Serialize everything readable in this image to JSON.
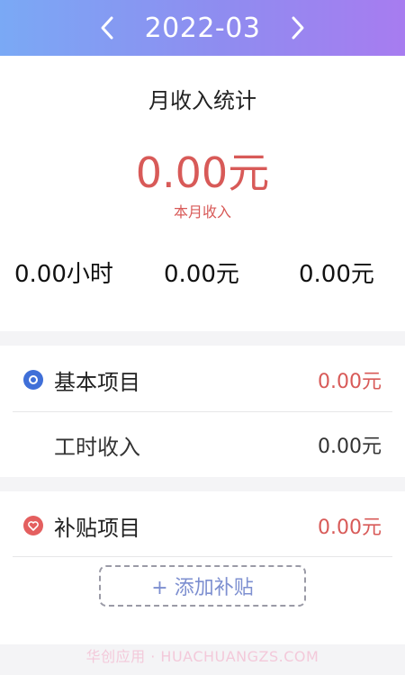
{
  "header": {
    "month": "2022-03",
    "prev_icon": "chevron-left-icon",
    "next_icon": "chevron-right-icon"
  },
  "summary": {
    "title": "月收入统计",
    "amount": "0.00元",
    "amount_label": "本月收入",
    "stats": [
      "0.00小时",
      "0.00元",
      "0.00元"
    ]
  },
  "basic": {
    "title": "基本项目",
    "total": "0.00元",
    "items": [
      {
        "label": "工时收入",
        "value": "0.00元"
      }
    ],
    "icon": "circle-dot-icon"
  },
  "subsidy": {
    "title": "补贴项目",
    "total": "0.00元",
    "add_label": "+ 添加补贴",
    "icon": "heart-icon"
  },
  "watermark": "华创应用 · HUACHUANGZS.COM",
  "colors": {
    "accent": "#d85a58",
    "blue": "#3f6fd8",
    "header_start": "#7aa9f5",
    "header_end": "#a77cf0"
  }
}
